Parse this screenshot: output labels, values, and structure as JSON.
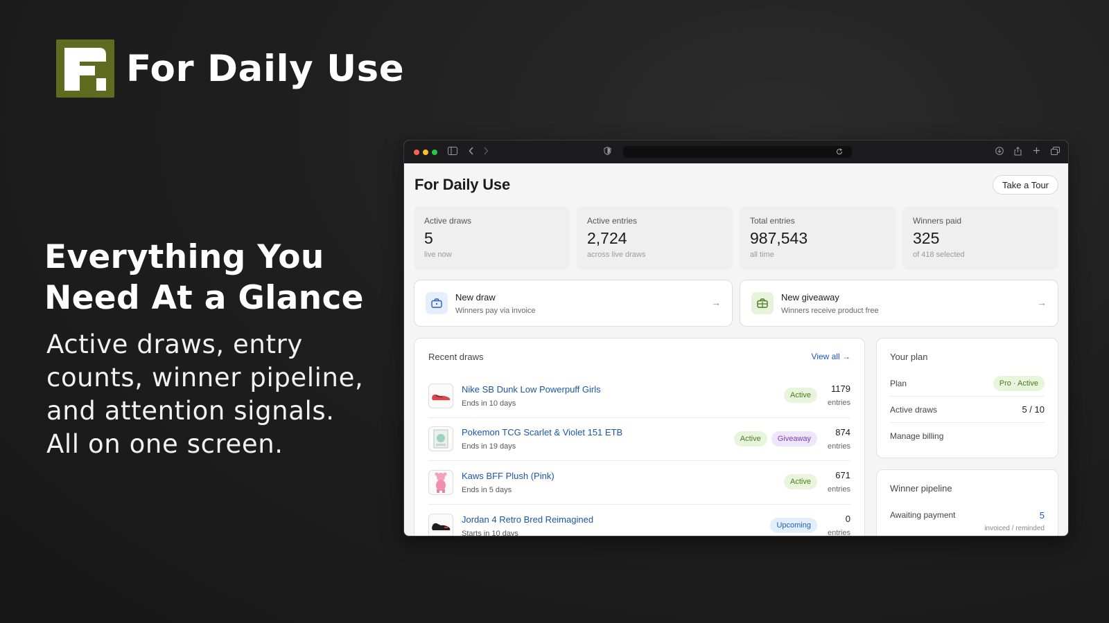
{
  "brand": {
    "logo_letter": "F",
    "name": "For Daily Use",
    "logo_color": "#5f6b1e"
  },
  "hero": {
    "title_line1": "Everything You",
    "title_line2": "Need At a Glance",
    "sub_line1": "Active draws, entry",
    "sub_line2": "counts, winner pipeline,",
    "sub_line3": "and attention signals.",
    "sub_line4": "All on one screen."
  },
  "browser": {
    "traffic_lights": [
      "#fe5f57",
      "#febc2e",
      "#28c840"
    ]
  },
  "app": {
    "title": "For Daily Use",
    "tour_button": "Take a Tour",
    "stats": [
      {
        "label": "Active draws",
        "value": "5",
        "sub": "live now"
      },
      {
        "label": "Active entries",
        "value": "2,724",
        "sub": "across live draws"
      },
      {
        "label": "Total entries",
        "value": "987,543",
        "sub": "all time"
      },
      {
        "label": "Winners paid",
        "value": "325",
        "sub": "of 418 selected"
      }
    ],
    "actions": [
      {
        "title": "New draw",
        "sub": "Winners pay via invoice",
        "icon": "briefcase-icon",
        "arrow": "→"
      },
      {
        "title": "New giveaway",
        "sub": "Winners receive product free",
        "icon": "gift-icon",
        "arrow": "→"
      }
    ],
    "recent": {
      "title": "Recent draws",
      "view_all": "View all →",
      "rows": [
        {
          "name": "Nike SB Dunk Low Powerpuff Girls",
          "sub": "Ends in 10 days",
          "badges": [
            "Active"
          ],
          "entries": "1179",
          "entries_label": "entries",
          "thumb": "sneaker-icon"
        },
        {
          "name": "Pokemon TCG Scarlet & Violet 151 ETB",
          "sub": "Ends in 19 days",
          "badges": [
            "Active",
            "Giveaway"
          ],
          "entries": "874",
          "entries_label": "entries",
          "thumb": "card-box-icon"
        },
        {
          "name": "Kaws BFF Plush (Pink)",
          "sub": "Ends in 5 days",
          "badges": [
            "Active"
          ],
          "entries": "671",
          "entries_label": "entries",
          "thumb": "plush-icon"
        },
        {
          "name": "Jordan 4 Retro Bred Reimagined",
          "sub": "Starts in 10 days",
          "badges": [
            "Upcoming"
          ],
          "entries": "0",
          "entries_label": "entries",
          "thumb": "sneaker-icon"
        }
      ]
    },
    "plan": {
      "title": "Your plan",
      "plan_label": "Plan",
      "plan_value": "Pro · Active",
      "draws_label": "Active draws",
      "draws_value": "5 / 10",
      "billing_label": "Manage billing"
    },
    "pipeline": {
      "title": "Winner pipeline",
      "awaiting_label": "Awaiting payment",
      "awaiting_value": "5",
      "awaiting_sub": "invoiced / reminded"
    }
  }
}
